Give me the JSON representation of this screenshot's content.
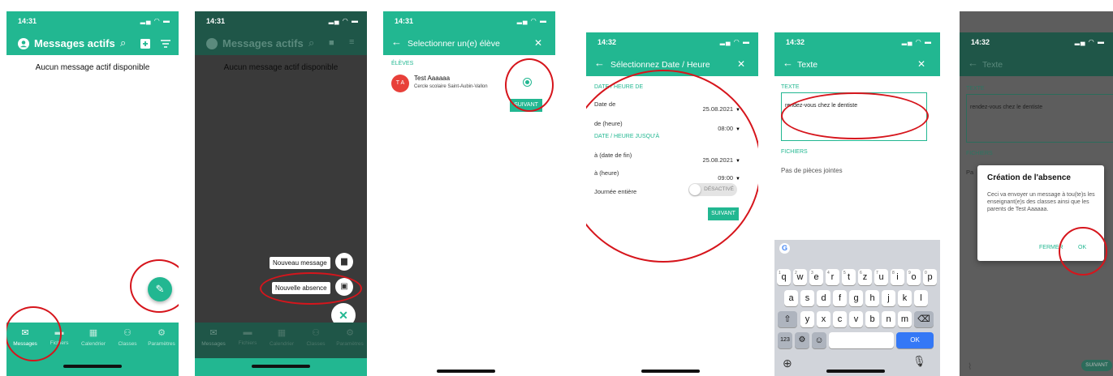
{
  "colors": {
    "primary": "#22b791",
    "dark_overlay": "#3a3a3a",
    "red": "#d6151c",
    "keyboard_bg": "#d1d4da",
    "key": "#ffffff",
    "blue": "#3478f6"
  },
  "screen1": {
    "time": "14:31",
    "title": "Messages actifs",
    "empty": "Aucun message actif disponible",
    "tabs": [
      "Messages",
      "Fichiers",
      "Calendrier",
      "Classes",
      "Paramètres"
    ]
  },
  "screen2": {
    "time": "14:31",
    "title": "Messages actifs",
    "empty": "Aucun message actif disponible",
    "fab_new_message": "Nouveau message",
    "fab_new_absence": "Nouvelle absence",
    "tabs": [
      "Messages",
      "Fichiers",
      "Calendrier",
      "Classes",
      "Paramètres"
    ]
  },
  "screen3": {
    "time": "14:31",
    "title": "Selectionner un(e) élève",
    "section": "ÉLÈVES",
    "student_initials": "T A",
    "student_name": "Test Aaaaaa",
    "student_school": "Cercle scolaire Saint-Aubin-Vallon",
    "next": "SUIVANT"
  },
  "screen4": {
    "time": "14:32",
    "title": "Sélectionnez Date / Heure",
    "section_from": "DATE / HEURE DE",
    "date_from_label": "Date de",
    "date_from_value": "25.08.2021",
    "time_from_label": "de (heure)",
    "time_from_value": "08:00",
    "section_to": "DATE / HEURE JUSQU'À",
    "date_to_label": "à (date de fin)",
    "date_to_value": "25.08.2021",
    "time_to_label": "à (heure)",
    "time_to_value": "09:00",
    "allday_label": "Journée entière",
    "allday_toggle": "DÉSACTIVÉ",
    "next": "SUIVANT"
  },
  "screen5": {
    "time": "14:32",
    "title": "Texte",
    "section_text": "TEXTE",
    "text_value": "rendez-vous chez le dentiste",
    "section_files": "FICHIERS",
    "no_attachments": "Pas de pièces jointes",
    "keyboard_row1": [
      "q",
      "w",
      "e",
      "r",
      "t",
      "z",
      "u",
      "i",
      "o",
      "p"
    ],
    "keyboard_row1_hints": [
      "1",
      "2",
      "3",
      "4",
      "5",
      "6",
      "7",
      "8",
      "9",
      "0"
    ],
    "keyboard_row2": [
      "a",
      "s",
      "d",
      "f",
      "g",
      "h",
      "j",
      "k",
      "l"
    ],
    "keyboard_row3": [
      "y",
      "x",
      "c",
      "v",
      "b",
      "n",
      "m"
    ],
    "key_numbers": "123",
    "key_ok": "OK"
  },
  "screen6": {
    "time": "14:32",
    "title": "Texte",
    "section_text": "TEXTE",
    "text_value": "rendez-vous chez le dentiste",
    "section_files": "FICHIERS",
    "files_partial": "Pa",
    "dialog_title": "Création de l'absence",
    "dialog_body": "Ceci va envoyer un message à tou(te)s les enseignant(e)s des classes ainsi que les parents de Test Aaaaaa.",
    "dialog_cancel": "FERMER",
    "dialog_ok": "OK",
    "next": "SUIVANT"
  }
}
